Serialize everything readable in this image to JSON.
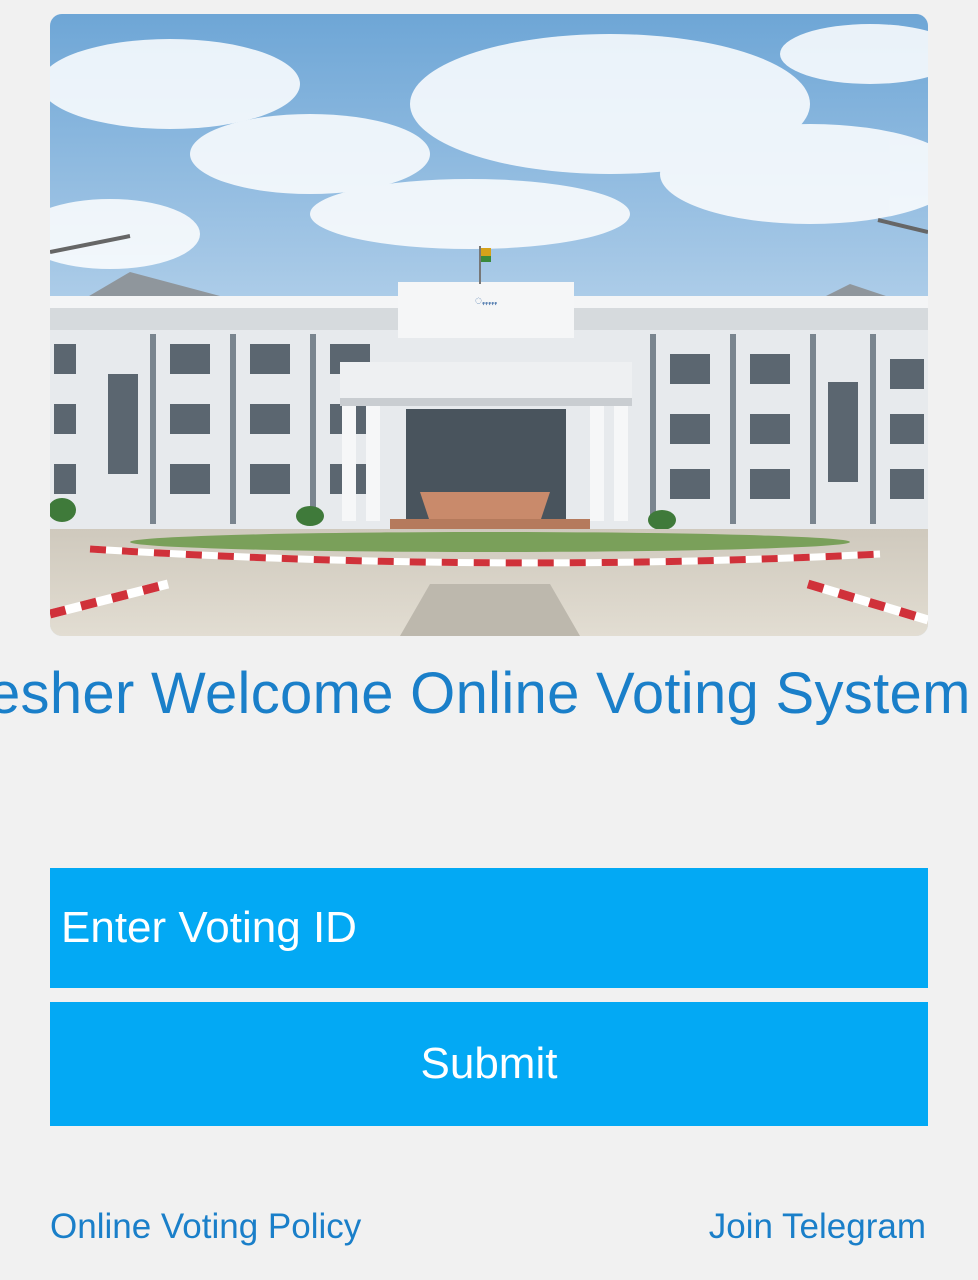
{
  "hero": {
    "image_label": "building-photo"
  },
  "marquee": {
    "text": "esher Welcome Online Voting System"
  },
  "form": {
    "voting_id_placeholder": "Enter Voting ID",
    "voting_id_value": "",
    "submit_label": "Submit"
  },
  "footer": {
    "policy_link": "Online Voting Policy",
    "telegram_link": "Join Telegram"
  },
  "colors": {
    "accent": "#03a9f4",
    "link": "#1a7fc9",
    "background": "#f1f1f1"
  }
}
